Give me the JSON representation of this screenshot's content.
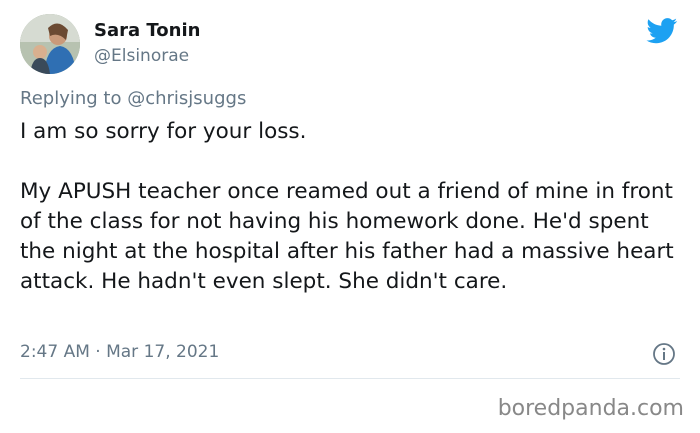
{
  "tweet": {
    "author_name": "Sara Tonin",
    "author_handle": "@Elsinorae",
    "replying_prefix": "Replying to",
    "replying_handle": "@chrisjsuggs",
    "paragraph1": "I am so sorry for your loss.",
    "paragraph2": "My APUSH teacher once reamed out a friend of mine in front of the class for not having his homework done. He'd spent the night at the hospital after his father had a massive heart attack. He hadn't even slept. She didn't care.",
    "timestamp": "2:47 AM · Mar 17, 2021"
  },
  "icons": {
    "brand": "twitter-bird-icon",
    "info": "info-icon"
  },
  "colors": {
    "twitter_blue": "#1da1f2",
    "text": "#14171a",
    "muted": "#657786"
  },
  "watermark": "boredpanda.com"
}
